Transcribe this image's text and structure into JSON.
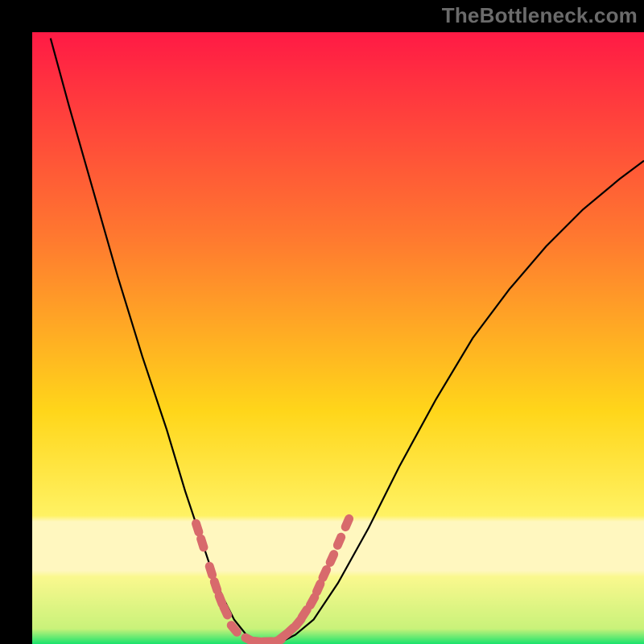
{
  "watermark": "TheBottleneck.com",
  "colors": {
    "frame": "#000000",
    "gradient_top": "#ff1a45",
    "gradient_mid1": "#ff7a2f",
    "gradient_mid2": "#ffd61a",
    "gradient_band": "#fff7bf",
    "gradient_bottom": "#19e36c",
    "curve": "#000000",
    "marker": "#d86a6c"
  },
  "chart_data": {
    "type": "line",
    "title": "",
    "xlabel": "",
    "ylabel": "",
    "xlim": [
      0,
      100
    ],
    "ylim": [
      0,
      100
    ],
    "series": [
      {
        "name": "curve",
        "x": [
          3,
          6,
          10,
          14,
          18,
          22,
          25,
          27,
          29,
          31,
          33,
          35,
          37,
          39,
          41,
          43,
          46,
          50,
          55,
          60,
          66,
          72,
          78,
          84,
          90,
          96,
          100
        ],
        "y": [
          99,
          88,
          74,
          60,
          47,
          35,
          25,
          19,
          13,
          8,
          4,
          1.5,
          0.5,
          0.3,
          0.5,
          1.5,
          4,
          10,
          19,
          29,
          40,
          50,
          58,
          65,
          71,
          76,
          79
        ]
      }
    ],
    "markers": {
      "name": "bottleneck-markers",
      "x": [
        27,
        27.8,
        29.2,
        30,
        30.8,
        31.6,
        33,
        35.5,
        37,
        38.5,
        40,
        41,
        42.2,
        43.5,
        44.5,
        45.8,
        46.8,
        47.8,
        49,
        50.2,
        51.5
      ],
      "y": [
        19,
        16.5,
        12,
        9.5,
        7.2,
        5.4,
        2.5,
        0.7,
        0.4,
        0.4,
        0.5,
        1.2,
        2.2,
        3.5,
        5,
        7,
        9.2,
        11.5,
        14,
        16.8,
        19.8
      ]
    }
  }
}
